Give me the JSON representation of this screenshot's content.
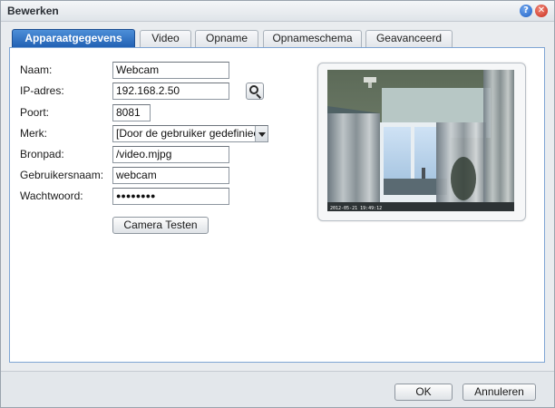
{
  "window": {
    "title": "Bewerken"
  },
  "icons": {
    "help": "help-icon",
    "close": "close-icon",
    "search": "magnifier-icon"
  },
  "tabs": [
    {
      "label": "Apparaatgegevens",
      "active": true
    },
    {
      "label": "Video",
      "active": false
    },
    {
      "label": "Opname",
      "active": false
    },
    {
      "label": "Opnameschema",
      "active": false
    },
    {
      "label": "Geavanceerd",
      "active": false
    }
  ],
  "form": {
    "name_label": "Naam:",
    "name_value": "Webcam",
    "ip_label": "IP-adres:",
    "ip_value": "192.168.2.50",
    "port_label": "Poort:",
    "port_value": "8081",
    "brand_label": "Merk:",
    "brand_value": "[Door de gebruiker gedefinieerd]",
    "path_label": "Bronpad:",
    "path_value": "/video.mjpg",
    "user_label": "Gebruikersnaam:",
    "user_value": "webcam",
    "password_label": "Wachtwoord:",
    "password_value": "●●●●●●●●",
    "test_button": "Camera Testen"
  },
  "footer": {
    "ok_label": "OK",
    "cancel_label": "Annuleren"
  },
  "colors": {
    "accent": "#1f5eb2",
    "panel_border": "#7fa6d4"
  }
}
